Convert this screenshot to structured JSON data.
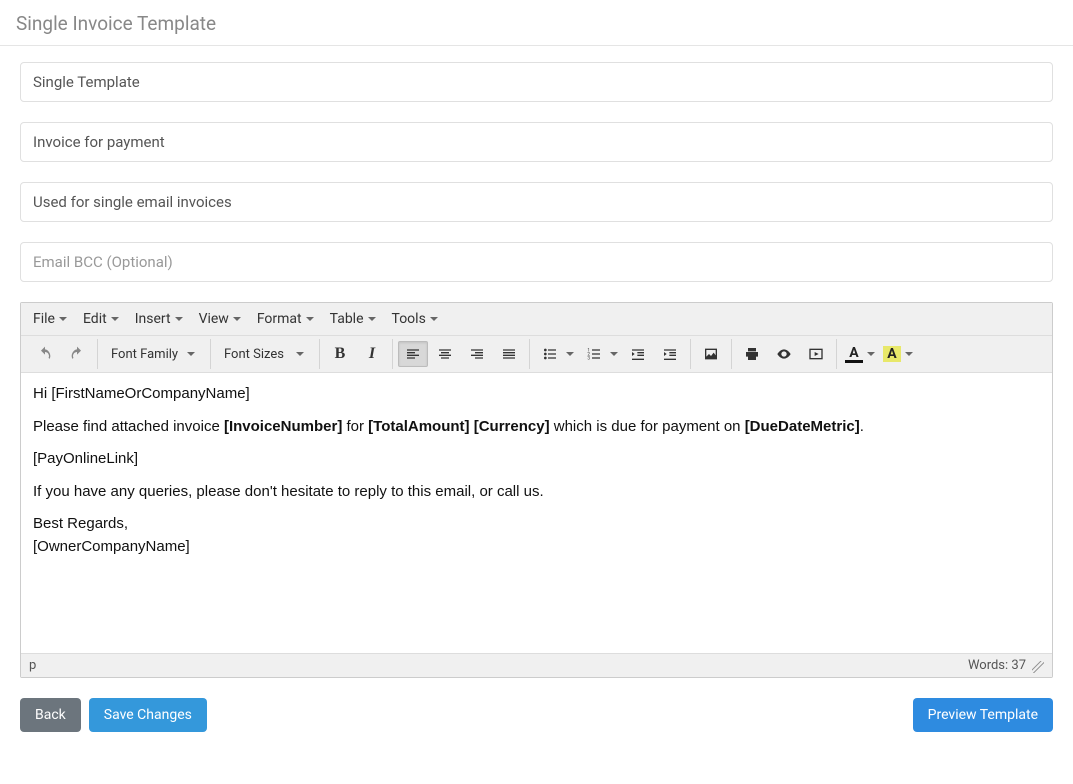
{
  "page_title": "Single Invoice Template",
  "fields": {
    "template_name": "Single Template",
    "subject": "Invoice for payment",
    "description": "Used for single email invoices",
    "bcc": "",
    "bcc_placeholder": "Email BCC (Optional)"
  },
  "editor": {
    "menubar": [
      "File",
      "Edit",
      "Insert",
      "View",
      "Format",
      "Table",
      "Tools"
    ],
    "font_family_label": "Font Family",
    "font_sizes_label": "Font Sizes",
    "body": {
      "line1_pre": "Hi ",
      "line1_token": "[FirstNameOrCompanyName]",
      "line2_pre": "Please find attached invoice ",
      "line2_t1": "[InvoiceNumber]",
      "line2_mid1": " for ",
      "line2_t2": "[TotalAmount]",
      "line2_sp": " ",
      "line2_t3": "[Currency]",
      "line2_mid2": " which is due for payment on ",
      "line2_t4": "[DueDateMetric]",
      "line2_end": ".",
      "line3": "[PayOnlineLink]",
      "line4": "If you have any queries, please don't hesitate to reply to this email, or call us.",
      "line5a": "Best Regards,",
      "line5b": "[OwnerCompanyName]"
    },
    "status_path": "p",
    "word_count_label": "Words: 37"
  },
  "buttons": {
    "back": "Back",
    "save": "Save Changes",
    "preview": "Preview Template"
  }
}
